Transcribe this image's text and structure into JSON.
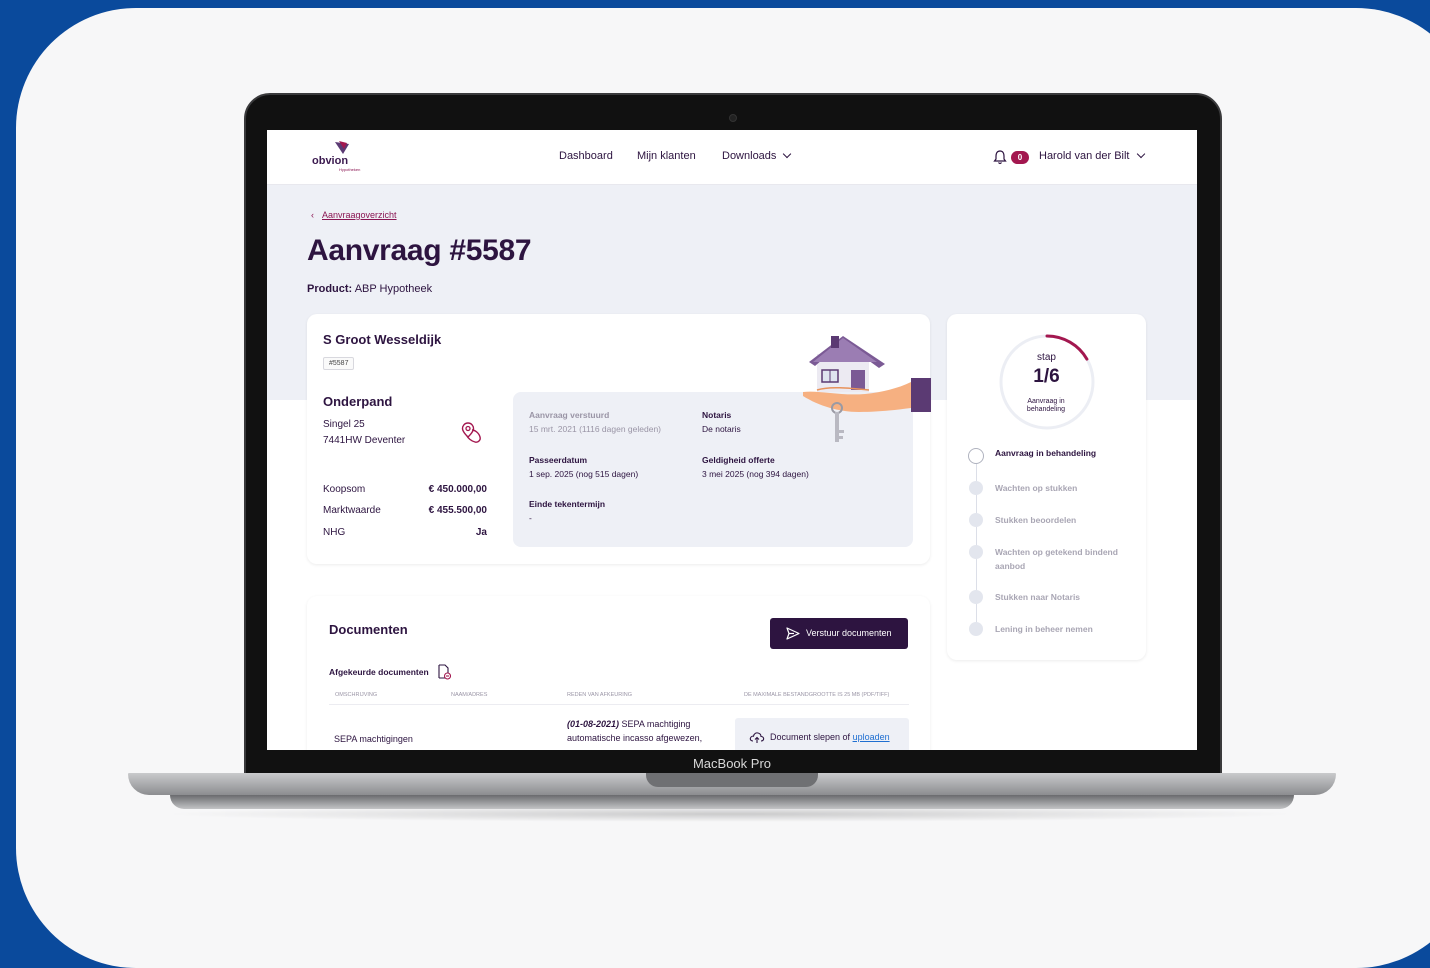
{
  "device": {
    "label": "MacBook Pro"
  },
  "nav": {
    "logo_text": "obvion",
    "logo_sub": "Hypotheken",
    "links": [
      "Dashboard",
      "Mijn klanten",
      "Downloads"
    ],
    "notification_count": "0",
    "user_name": "Harold van der Bilt"
  },
  "breadcrumb": {
    "back_label": "Aanvraagoverzicht"
  },
  "page": {
    "title": "Aanvraag #5587",
    "product_label": "Product:",
    "product_value": "ABP Hypotheek"
  },
  "application": {
    "client_name": "S Groot Wesseldijk",
    "id_tag": "#5587",
    "collateral_heading": "Onderpand",
    "address_line1": "Singel 25",
    "address_line2": "7441HW Deventer",
    "financials": [
      {
        "label": "Koopsom",
        "value": "€ 450.000,00"
      },
      {
        "label": "Marktwaarde",
        "value": "€ 455.500,00"
      },
      {
        "label": "NHG",
        "value": "Ja"
      }
    ],
    "info": {
      "sent_label": "Aanvraag verstuurd",
      "sent_value": "15 mrt. 2021 (1116 dagen geleden)",
      "notary_label": "Notaris",
      "notary_value": "De notaris",
      "passing_label": "Passeerdatum",
      "passing_value": "1 sep. 2025 (nog 515 dagen)",
      "validity_label": "Geldigheid offerte",
      "validity_value": "3 mei 2025 (nog 394 dagen)",
      "sign_label": "Einde tekentermijn",
      "sign_value": "-"
    }
  },
  "progress": {
    "step_word": "stap",
    "step_fraction": "1/6",
    "ring_label": "Aanvraag in behandeling",
    "fraction_complete": 0.1667,
    "steps": [
      "Aanvraag in behandeling",
      "Wachten op stukken",
      "Stukken beoordelen",
      "Wachten op getekend bindend aanbod",
      "Stukken naar Notaris",
      "Lening in beheer nemen"
    ],
    "active_index": 0
  },
  "documents": {
    "title": "Documenten",
    "send_button": "Verstuur documenten",
    "rejected_heading": "Afgekeurde documenten",
    "columns": [
      "OMSCHRIJVING",
      "NAAM/ADRES",
      "REDEN VAN AFKEURING",
      "DE MAXIMALE BESTANDGROOTTE IS 25 MB (PDF/TIFF)"
    ],
    "rows": [
      {
        "description": "SEPA machtigingen",
        "reason_date": "(01-08-2021)",
        "reason_text": "SEPA machtiging automatische incasso afgewezen,",
        "upload_text": "Document slepen of",
        "upload_link": "uploaden"
      }
    ]
  },
  "colors": {
    "brand": "#2d1440",
    "accent": "#a3174f",
    "background": "#0a4a9c"
  }
}
